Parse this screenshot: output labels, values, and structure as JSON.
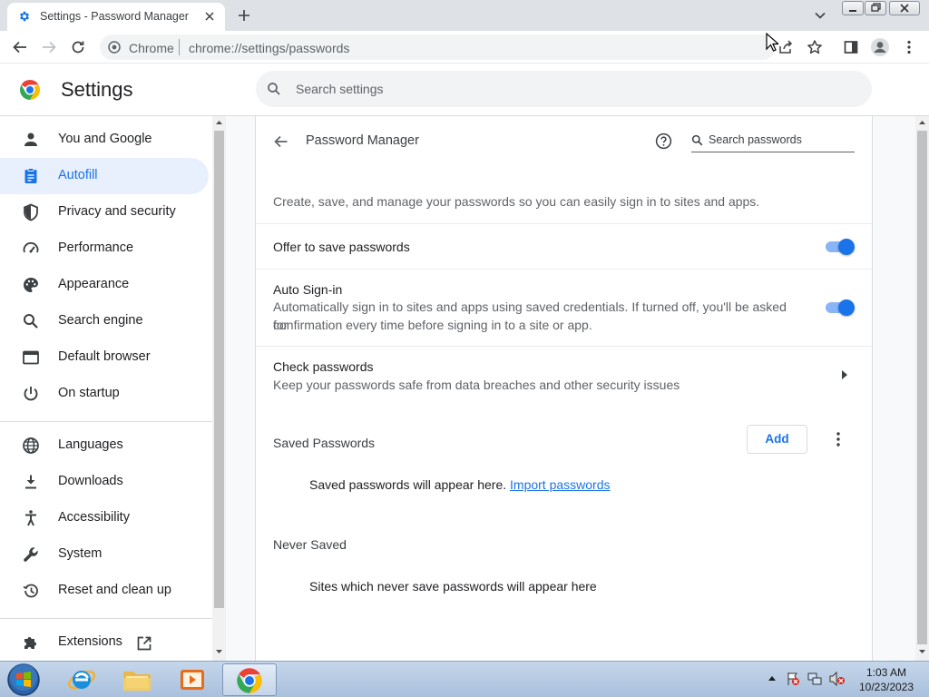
{
  "browser": {
    "tab_title": "Settings - Password Manager",
    "omnibox_origin": "Chrome",
    "omnibox_url": "chrome://settings/passwords"
  },
  "settings": {
    "title": "Settings",
    "search_placeholder": "Search settings"
  },
  "sidebar": {
    "items": [
      {
        "label": "You and Google",
        "icon": "person-icon"
      },
      {
        "label": "Autofill",
        "icon": "clipboard-icon",
        "active": true
      },
      {
        "label": "Privacy and security",
        "icon": "shield-icon"
      },
      {
        "label": "Performance",
        "icon": "gauge-icon"
      },
      {
        "label": "Appearance",
        "icon": "palette-icon"
      },
      {
        "label": "Search engine",
        "icon": "search-icon"
      },
      {
        "label": "Default browser",
        "icon": "browser-icon"
      },
      {
        "label": "On startup",
        "icon": "power-icon"
      },
      {
        "label": "Languages",
        "icon": "globe-icon"
      },
      {
        "label": "Downloads",
        "icon": "download-icon"
      },
      {
        "label": "Accessibility",
        "icon": "accessibility-icon"
      },
      {
        "label": "System",
        "icon": "wrench-icon"
      },
      {
        "label": "Reset and clean up",
        "icon": "restore-icon"
      },
      {
        "label": "Extensions",
        "icon": "puzzle-icon"
      }
    ]
  },
  "password_manager": {
    "title": "Password Manager",
    "search_placeholder": "Search passwords",
    "description": "Create, save, and manage your passwords so you can easily sign in to sites and apps.",
    "offer_to_save": {
      "label": "Offer to save passwords",
      "enabled": true
    },
    "auto_signin": {
      "label": "Auto Sign-in",
      "sub_line1": "Automatically sign in to sites and apps using saved credentials. If turned off, you'll be asked for",
      "sub_line2": "confirmation every time before signing in to a site or app.",
      "enabled": true
    },
    "check_passwords": {
      "label": "Check passwords",
      "sub": "Keep your passwords safe from data breaches and other security issues"
    },
    "saved_passwords": {
      "title": "Saved Passwords",
      "add_label": "Add",
      "empty_text": "Saved passwords will appear here.",
      "import_link": "Import passwords"
    },
    "never_saved": {
      "title": "Never Saved",
      "empty_text": "Sites which never save passwords will appear here"
    }
  },
  "taskbar": {
    "time": "1:03 AM",
    "date": "10/23/2023"
  },
  "colors": {
    "accent": "#1a73e8",
    "active_nav_bg": "#e8f0fe",
    "toggle_track": "#8ab4f8"
  }
}
